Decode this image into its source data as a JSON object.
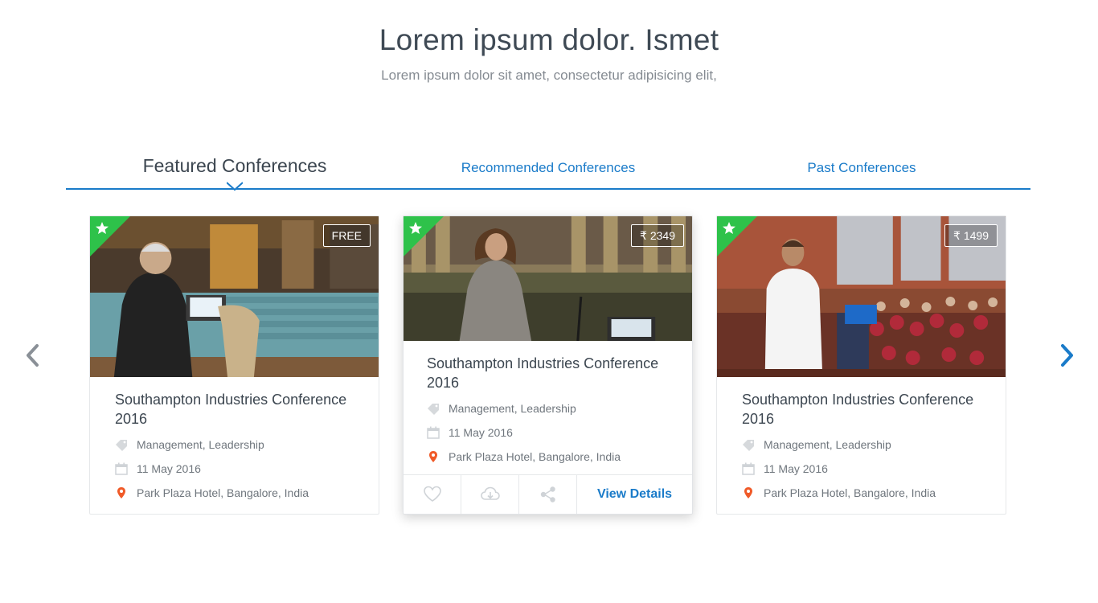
{
  "hero": {
    "title": "Lorem ipsum dolor. Ismet",
    "subtitle": "Lorem ipsum dolor sit amet, consectetur adipisicing elit,"
  },
  "tabs": [
    {
      "label": "Featured Conferences",
      "active": true
    },
    {
      "label": "Recommended Conferences",
      "active": false
    },
    {
      "label": "Past Conferences",
      "active": false
    }
  ],
  "colors": {
    "accent": "#1a7bc9",
    "ribbon": "#2ec24a",
    "location": "#f05a28"
  },
  "cards": [
    {
      "price": "FREE",
      "title": "Southampton Industries Conference 2016",
      "tags": "Management, Leadership",
      "date": "11 May 2016",
      "location": "Park Plaza Hotel, Bangalore, India"
    },
    {
      "price": "₹ 2349",
      "title": "Southampton Industries Conference 2016",
      "tags": "Management, Leadership",
      "date": "11 May 2016",
      "location": "Park Plaza Hotel, Bangalore, India",
      "action_label": "View Details"
    },
    {
      "price": "₹ 1499",
      "title": "Southampton Industries Conference 2016",
      "tags": "Management, Leadership",
      "date": "11 May 2016",
      "location": "Park Plaza Hotel, Bangalore, India"
    }
  ],
  "icons": {
    "featured": "star-icon",
    "tags": "tag-icon",
    "date": "calendar-icon",
    "location": "map-pin-icon",
    "favorite": "heart-icon",
    "download": "cloud-download-icon",
    "share": "share-icon",
    "prev": "chevron-left-icon",
    "next": "chevron-right-icon"
  }
}
